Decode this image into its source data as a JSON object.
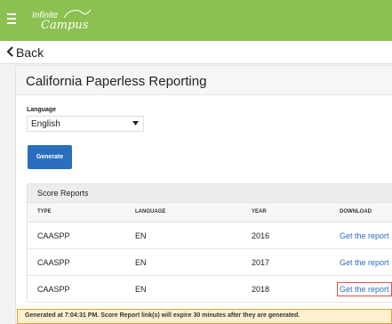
{
  "header": {
    "logo_line1": "Infinite",
    "logo_line2": "Campus",
    "menu_icon": "hamburger-icon"
  },
  "nav": {
    "back_label": "Back",
    "back_icon": "chevron-left-icon"
  },
  "page": {
    "title": "California Paperless Reporting"
  },
  "language": {
    "label": "Language",
    "value": "English",
    "caret_icon": "caret-down-icon"
  },
  "actions": {
    "generate_label": "Generate"
  },
  "table": {
    "caption": "Score Reports",
    "columns": [
      "TYPE",
      "LANGUAGE",
      "YEAR",
      "DOWNLOAD"
    ],
    "rows": [
      {
        "type": "CAASPP",
        "language": "EN",
        "year": "2016",
        "download": "Get the report"
      },
      {
        "type": "CAASPP",
        "language": "EN",
        "year": "2017",
        "download": "Get the report"
      },
      {
        "type": "CAASPP",
        "language": "EN",
        "year": "2018",
        "download": "Get the report"
      }
    ]
  },
  "notice": {
    "text": "Generated at 7:04:31 PM. Score Report link(s) will expire 30 minutes after they are generated."
  },
  "colors": {
    "brand_green": "#8cc152",
    "link_blue": "#2a6ebe",
    "notice_border": "#e8a23a",
    "highlight_red": "#d9534f"
  }
}
